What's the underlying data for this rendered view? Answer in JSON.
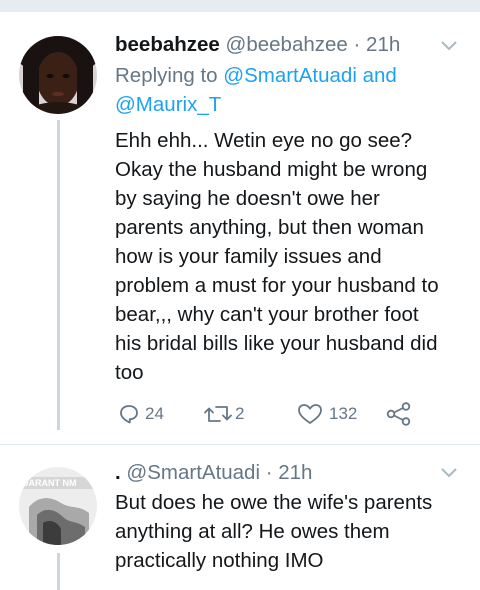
{
  "tweet1": {
    "name": "beebahzee",
    "handle": "@beebahzee",
    "time": "· 21h",
    "replying_prefix": "Replying to",
    "reply_to_1": "@SmartAtuadi",
    "reply_and": "and",
    "reply_to_2": "@Maurix_T",
    "body_lines": [
      "Ehh ehh... Wetin eye no go see?",
      "Okay the husband might be wrong",
      "by saying he doesn't owe her",
      "parents anything, but then woman",
      "how is your family issues and",
      "problem a must for your husband to",
      "bear,,, why can't your brother foot",
      "his bridal bills like your husband did",
      "too"
    ],
    "replies": "24",
    "retweets": "2",
    "likes": "132"
  },
  "tweet2": {
    "name": ".",
    "handle": "@SmartAtuadi",
    "time": "· 21h",
    "avatar_text": "UARANT NM",
    "body_lines": [
      "But does he owe the wife's parents",
      "anything at all? He owes them",
      "practically nothing IMO"
    ]
  },
  "icons": {
    "reply": "reply-icon",
    "retweet": "retweet-icon",
    "like": "heart-icon",
    "share": "share-icon",
    "menu": "chevron-down-icon"
  },
  "colors": {
    "link": "#1da1f2",
    "meta": "#657786",
    "thread_line": "#ccd6dd"
  }
}
